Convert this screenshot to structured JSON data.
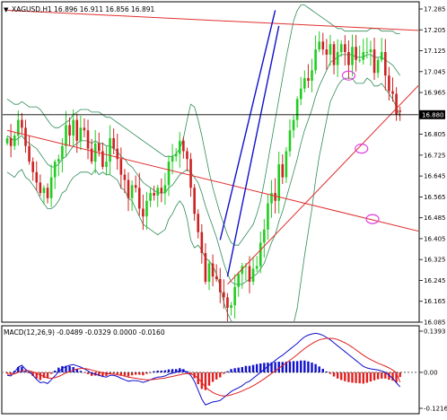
{
  "header": {
    "symbol_line": "XAGUSD,H1  16.896 16.911 16.856 16.891"
  },
  "price_axis": {
    "ticks": [
      "17.285",
      "17.205",
      "17.125",
      "17.045",
      "16.965",
      "16.885",
      "16.805",
      "16.725",
      "16.645",
      "16.565",
      "16.485",
      "16.405",
      "16.325",
      "16.245",
      "16.165",
      "16.085"
    ],
    "current_label": "16.880"
  },
  "macd": {
    "label": "MACD(12,26,9) -0.0489 -0.0329 0.0000 -0.0160",
    "ticks": [
      "0.1393",
      "0.00",
      "-0.1216"
    ]
  },
  "colors": {
    "up_candle": "#22cc22",
    "down_candle": "#cc2222",
    "bollinger": "#2e8b57",
    "trendline_red": "#e03030",
    "trendline_blue": "#1010cc",
    "ellipse": "#e040e0",
    "macd_line": "#1010cc",
    "signal_line": "#e02020",
    "hist_positive": "#1010cc",
    "hist_negative": "#e02020",
    "current_price_box": "#000000"
  },
  "chart_data": [
    {
      "type": "candlestick",
      "symbol": "XAGUSD",
      "timeframe": "H1",
      "last_bar": {
        "open": 16.896,
        "high": 16.911,
        "low": 16.856,
        "close": 16.891
      },
      "ylim": [
        16.085,
        17.285
      ],
      "current_price": 16.88,
      "closes": [
        16.79,
        16.76,
        16.8,
        16.86,
        16.83,
        16.76,
        16.7,
        16.66,
        16.62,
        16.58,
        16.6,
        16.56,
        16.64,
        16.7,
        16.71,
        16.76,
        16.84,
        16.8,
        16.86,
        16.78,
        16.83,
        16.82,
        16.75,
        16.7,
        16.77,
        16.74,
        16.68,
        16.7,
        16.79,
        16.75,
        16.71,
        16.65,
        16.63,
        16.56,
        16.61,
        16.6,
        16.52,
        16.49,
        16.55,
        16.58,
        16.57,
        16.6,
        16.58,
        16.61,
        16.7,
        16.72,
        16.73,
        16.78,
        16.74,
        16.71,
        16.6,
        16.5,
        16.43,
        16.35,
        16.24,
        16.31,
        16.26,
        16.25,
        16.2,
        16.18,
        16.14,
        16.15,
        16.22,
        16.27,
        16.3,
        16.3,
        16.24,
        16.29,
        16.3,
        16.39,
        16.44,
        16.54,
        16.58,
        16.55,
        16.69,
        16.64,
        16.74,
        16.82,
        16.86,
        16.94,
        16.98,
        17.02,
        17.01,
        17.05,
        17.13,
        17.16,
        17.13,
        17.11,
        17.15,
        17.07,
        17.12,
        17.15,
        17.12,
        17.07,
        17.14,
        17.09,
        17.09,
        17.12,
        17.12,
        17.13,
        17.04,
        17.09,
        17.12,
        17.03,
        16.97,
        16.96,
        16.88,
        16.89
      ],
      "bollinger": {
        "middle": [
          16.8,
          16.79,
          16.78,
          16.79,
          16.8,
          16.78,
          16.77,
          16.76,
          16.75,
          16.73,
          16.71,
          16.69,
          16.68,
          16.68,
          16.69,
          16.71,
          16.72,
          16.74,
          16.76,
          16.77,
          16.78,
          16.78,
          16.78,
          16.77,
          16.78,
          16.77,
          16.77,
          16.76,
          16.76,
          16.75,
          16.74,
          16.72,
          16.71,
          16.69,
          16.68,
          16.66,
          16.64,
          16.62,
          16.61,
          16.6,
          16.59,
          16.58,
          16.58,
          16.58,
          16.6,
          16.61,
          16.63,
          16.65,
          16.66,
          16.67,
          16.66,
          16.64,
          16.62,
          16.58,
          16.53,
          16.49,
          16.45,
          16.41,
          16.36,
          16.31,
          16.27,
          16.24,
          16.23,
          16.23,
          16.23,
          16.24,
          16.25,
          16.26,
          16.27,
          16.29,
          16.31,
          16.35,
          16.39,
          16.42,
          16.47,
          16.51,
          16.56,
          16.61,
          16.66,
          16.71,
          16.77,
          16.82,
          16.86,
          16.9,
          16.95,
          16.99,
          17.02,
          17.05,
          17.08,
          17.09,
          17.1,
          17.11,
          17.11,
          17.11,
          17.11,
          17.1,
          17.1,
          17.1,
          17.11,
          17.11,
          17.1,
          17.1,
          17.1,
          17.09,
          17.08,
          17.07,
          17.05,
          17.03
        ],
        "upper": [
          16.94,
          16.93,
          16.92,
          16.92,
          16.93,
          16.92,
          16.91,
          16.91,
          16.91,
          16.9,
          16.88,
          16.86,
          16.84,
          16.83,
          16.83,
          16.84,
          16.85,
          16.86,
          16.88,
          16.89,
          16.9,
          16.9,
          16.9,
          16.89,
          16.89,
          16.89,
          16.88,
          16.87,
          16.87,
          16.86,
          16.85,
          16.84,
          16.83,
          16.82,
          16.81,
          16.8,
          16.79,
          16.78,
          16.77,
          16.76,
          16.75,
          16.74,
          16.73,
          16.72,
          16.72,
          16.72,
          16.73,
          16.75,
          16.79,
          16.86,
          16.92,
          16.91,
          16.86,
          16.8,
          16.73,
          16.66,
          16.6,
          16.55,
          16.5,
          16.46,
          16.42,
          16.39,
          16.38,
          16.38,
          16.4,
          16.42,
          16.44,
          16.46,
          16.5,
          16.55,
          16.62,
          16.7,
          16.78,
          16.86,
          16.94,
          17.02,
          17.1,
          17.17,
          17.24,
          17.28,
          17.3,
          17.3,
          17.29,
          17.28,
          17.27,
          17.26,
          17.25,
          17.24,
          17.23,
          17.22,
          17.21,
          17.21,
          17.2,
          17.2,
          17.2,
          17.2,
          17.2,
          17.2,
          17.2,
          17.21,
          17.21,
          17.21,
          17.2,
          17.2,
          17.2,
          17.2,
          17.19,
          17.19
        ],
        "lower": [
          16.66,
          16.65,
          16.64,
          16.66,
          16.67,
          16.64,
          16.63,
          16.61,
          16.59,
          16.56,
          16.54,
          16.52,
          16.52,
          16.53,
          16.55,
          16.58,
          16.59,
          16.62,
          16.64,
          16.65,
          16.66,
          16.66,
          16.66,
          16.65,
          16.67,
          16.65,
          16.66,
          16.65,
          16.65,
          16.64,
          16.63,
          16.6,
          16.59,
          16.56,
          16.55,
          16.52,
          16.49,
          16.46,
          16.45,
          16.44,
          16.43,
          16.42,
          16.43,
          16.44,
          16.48,
          16.5,
          16.53,
          16.55,
          16.53,
          16.48,
          16.4,
          16.37,
          16.38,
          16.36,
          16.33,
          16.32,
          16.3,
          16.27,
          16.22,
          16.16,
          16.12,
          16.09,
          16.08,
          16.08,
          16.06,
          16.06,
          16.06,
          16.06,
          16.04,
          16.03,
          16.0,
          16.0,
          16.0,
          15.98,
          16.0,
          16.0,
          16.02,
          16.05,
          16.08,
          16.14,
          16.24,
          16.34,
          16.43,
          16.52,
          16.63,
          16.72,
          16.79,
          16.86,
          16.93,
          16.96,
          16.99,
          17.01,
          17.02,
          17.02,
          17.02,
          17.0,
          17.0,
          17.0,
          17.02,
          17.01,
          16.99,
          16.99,
          17.0,
          16.98,
          16.96,
          16.94,
          16.91,
          16.87
        ]
      },
      "trendlines": [
        {
          "color": "red",
          "from": [
            0,
            17.28
          ],
          "to": [
            116,
            17.2
          ]
        },
        {
          "color": "red",
          "from": [
            0,
            16.82
          ],
          "to": [
            116,
            16.42
          ]
        },
        {
          "color": "red",
          "from": [
            60,
            16.23
          ],
          "to": [
            116,
            17.05
          ]
        },
        {
          "color": "blue",
          "from": [
            58,
            16.4
          ],
          "to": [
            73,
            17.28
          ]
        },
        {
          "color": "blue",
          "from": [
            60,
            16.26
          ],
          "to": [
            74,
            17.22
          ]
        }
      ],
      "ellipses": [
        {
          "x": 93,
          "y": 17.03
        },
        {
          "x": 96.5,
          "y": 16.75
        },
        {
          "x": 99.5,
          "y": 16.48
        }
      ]
    },
    {
      "type": "macd",
      "params": "12,26,9",
      "values": {
        "macd": -0.0489,
        "signal": -0.0329,
        "histogram": -0.016
      },
      "ylim": [
        -0.1216,
        0.1393
      ],
      "macd_line": [
        -0.01,
        -0.012,
        0.0,
        0.018,
        0.024,
        0.01,
        0.002,
        -0.01,
        -0.024,
        -0.035,
        -0.033,
        -0.038,
        -0.025,
        -0.012,
        0.002,
        0.013,
        0.02,
        0.024,
        0.026,
        0.022,
        0.018,
        0.012,
        0.005,
        -0.004,
        -0.006,
        -0.01,
        -0.014,
        -0.016,
        -0.01,
        -0.01,
        -0.014,
        -0.02,
        -0.025,
        -0.03,
        -0.028,
        -0.028,
        -0.03,
        -0.034,
        -0.03,
        -0.025,
        -0.02,
        -0.016,
        -0.015,
        -0.012,
        -0.006,
        -0.003,
        0.0,
        0.006,
        0.006,
        0.0,
        -0.01,
        -0.03,
        -0.06,
        -0.09,
        -0.11,
        -0.105,
        -0.1,
        -0.098,
        -0.095,
        -0.085,
        -0.075,
        -0.065,
        -0.058,
        -0.052,
        -0.045,
        -0.035,
        -0.03,
        -0.02,
        -0.01,
        0.0,
        0.01,
        0.02,
        0.03,
        0.04,
        0.05,
        0.058,
        0.068,
        0.078,
        0.088,
        0.098,
        0.11,
        0.12,
        0.126,
        0.13,
        0.132,
        0.13,
        0.125,
        0.118,
        0.11,
        0.1,
        0.09,
        0.08,
        0.07,
        0.06,
        0.05,
        0.04,
        0.03,
        0.02,
        0.015,
        0.012,
        0.01,
        0.008,
        0.005,
        0.0,
        -0.01,
        -0.02,
        -0.035,
        -0.049
      ],
      "signal_line": [
        -0.006,
        -0.007,
        -0.005,
        0.0,
        0.005,
        0.006,
        0.005,
        0.002,
        -0.003,
        -0.009,
        -0.014,
        -0.019,
        -0.02,
        -0.018,
        -0.014,
        -0.008,
        -0.002,
        0.003,
        0.008,
        0.011,
        0.013,
        0.013,
        0.011,
        0.008,
        0.005,
        0.002,
        -0.001,
        -0.004,
        -0.005,
        -0.006,
        -0.008,
        -0.01,
        -0.013,
        -0.016,
        -0.018,
        -0.02,
        -0.022,
        -0.024,
        -0.025,
        -0.025,
        -0.024,
        -0.022,
        -0.021,
        -0.019,
        -0.016,
        -0.014,
        -0.011,
        -0.008,
        -0.005,
        -0.004,
        -0.005,
        -0.01,
        -0.02,
        -0.034,
        -0.05,
        -0.06,
        -0.068,
        -0.074,
        -0.078,
        -0.08,
        -0.079,
        -0.076,
        -0.072,
        -0.068,
        -0.063,
        -0.057,
        -0.052,
        -0.045,
        -0.038,
        -0.03,
        -0.022,
        -0.013,
        -0.004,
        0.005,
        0.014,
        0.023,
        0.032,
        0.041,
        0.05,
        0.06,
        0.07,
        0.08,
        0.089,
        0.097,
        0.104,
        0.11,
        0.113,
        0.115,
        0.115,
        0.114,
        0.111,
        0.106,
        0.1,
        0.093,
        0.085,
        0.076,
        0.067,
        0.058,
        0.05,
        0.043,
        0.037,
        0.031,
        0.026,
        0.021,
        0.015,
        0.008,
        -0.001,
        -0.033
      ]
    }
  ]
}
